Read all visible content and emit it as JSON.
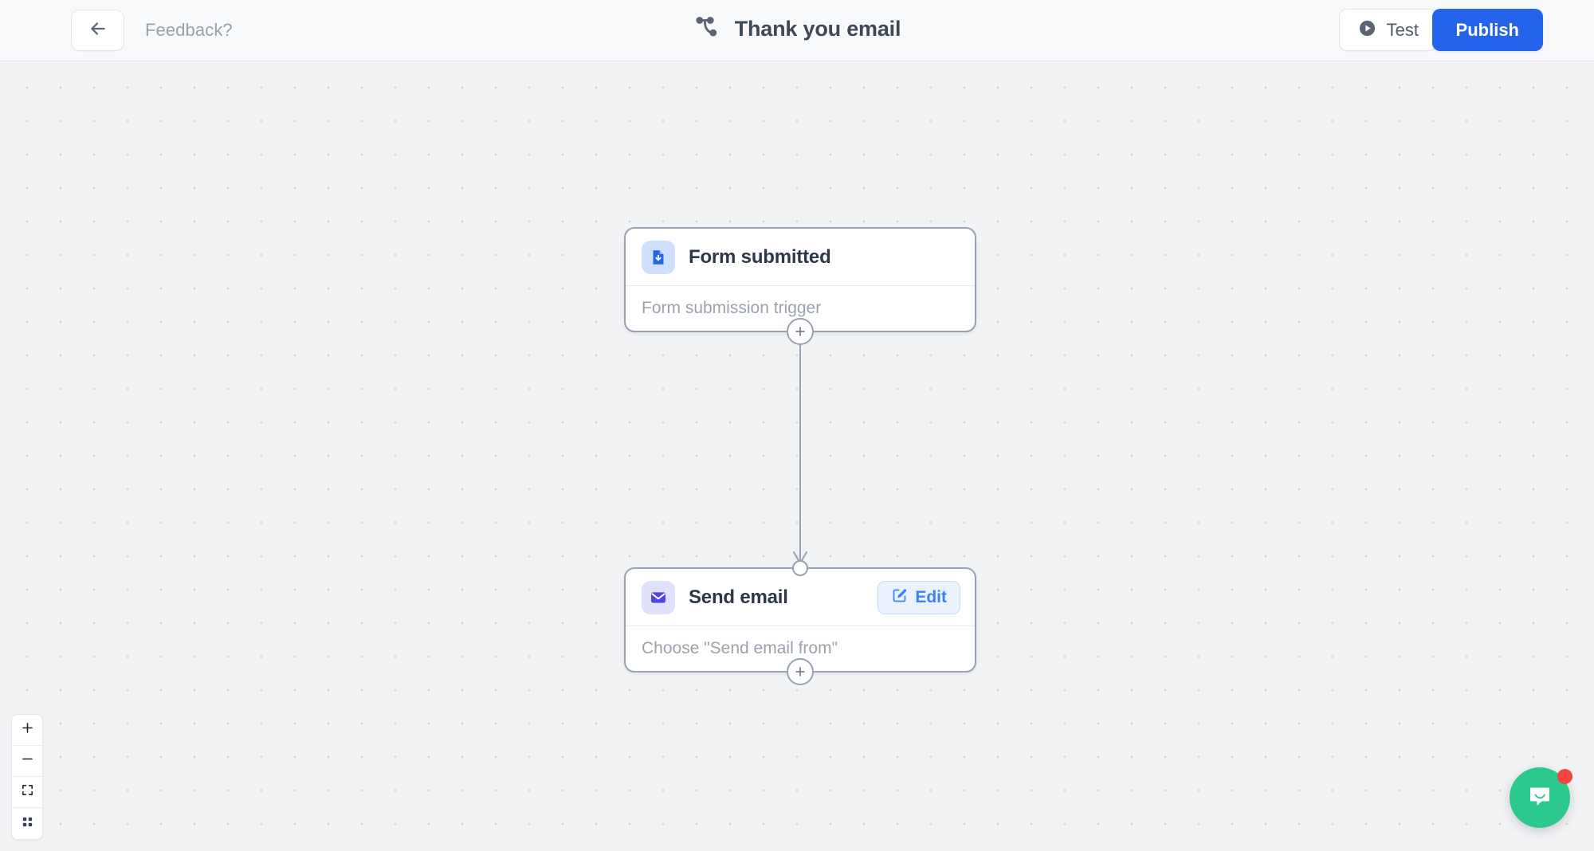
{
  "header": {
    "back_icon": "arrow-left-icon",
    "feedback_label": "Feedback?",
    "workflow_icon": "workflow-branch-icon",
    "title": "Thank you email",
    "test_label": "Test",
    "test_icon": "play-circle-icon",
    "publish_label": "Publish",
    "publish_color": "#2563eb"
  },
  "canvas": {
    "nodes": [
      {
        "icon": "form-download-icon",
        "icon_color": "#2563eb",
        "icon_bg": "#cfe0fd",
        "title": "Form submitted",
        "subtitle": "Form submission trigger",
        "has_edit_button": false,
        "add_icon": "plus-icon"
      },
      {
        "icon": "envelope-icon",
        "icon_color": "#4f46e5",
        "icon_bg": "#e0e1fc",
        "title": "Send email",
        "subtitle": "Choose \"Send email from\"",
        "has_edit_button": true,
        "edit_label": "Edit",
        "edit_icon": "pencil-square-icon",
        "edit_color": "#3b82f6",
        "add_icon": "plus-icon"
      }
    ],
    "connector": {
      "from": "Form submitted",
      "to": "Send email",
      "arrow": "down-arrow"
    },
    "background": "dot-grid",
    "background_color": "#f2f3f5"
  },
  "zoom_controls": [
    {
      "icon": "plus-icon",
      "name": "zoom-in"
    },
    {
      "icon": "minus-icon",
      "name": "zoom-out"
    },
    {
      "icon": "fit-screen-icon",
      "name": "fit-to-screen"
    },
    {
      "icon": "grid-dots-icon",
      "name": "toggle-grid"
    }
  ],
  "chat": {
    "icon": "chat-bubble-smile-icon",
    "color": "#2cc98f",
    "badge_color": "#f5453f",
    "has_badge": true
  }
}
